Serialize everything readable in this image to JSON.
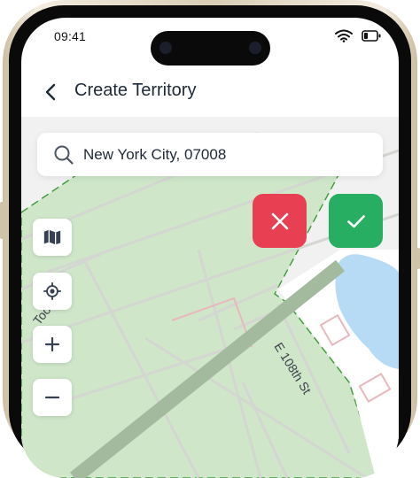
{
  "status_bar": {
    "time": "09:41"
  },
  "header": {
    "title": "Create Territory"
  },
  "search": {
    "value": "New York City, 07008"
  },
  "map": {
    "streets": [
      "E 108th St",
      "Tood Rd"
    ],
    "territory_fill": "#cfe6c9",
    "territory_border": "#3e9a3a",
    "water_color": "#b7daf5"
  },
  "actions": {
    "cancel_color": "#e84052",
    "confirm_color": "#27ae63"
  },
  "icons": [
    "back-arrow",
    "search",
    "close",
    "check",
    "map-layers",
    "locate",
    "zoom-in",
    "zoom-out",
    "wifi",
    "battery"
  ]
}
